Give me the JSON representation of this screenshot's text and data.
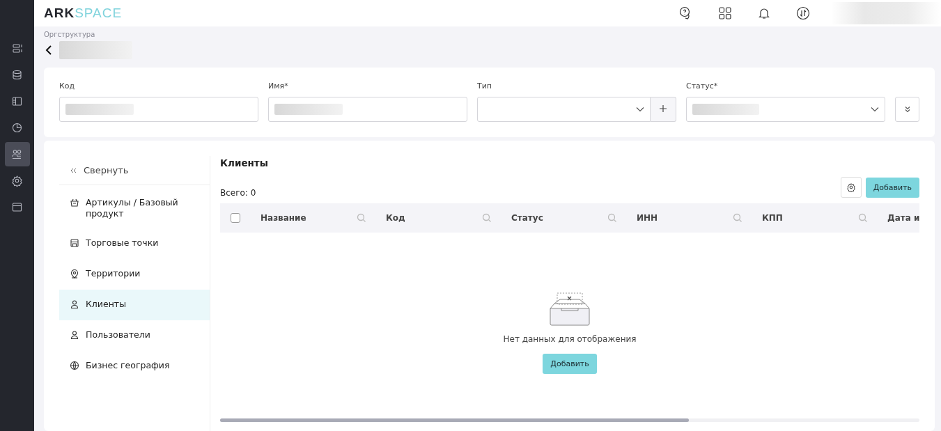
{
  "logo": {
    "bold": "ARK",
    "light": "SPACE"
  },
  "rail": [
    {
      "selected": false
    },
    {
      "selected": false
    },
    {
      "selected": false
    },
    {
      "selected": false
    },
    {
      "selected": true
    },
    {
      "selected": false
    },
    {
      "selected": false
    }
  ],
  "breadcrumb": "Оргструктура",
  "form_fields": [
    {
      "label": "Код",
      "kind": "text"
    },
    {
      "label": "Имя*",
      "kind": "text"
    },
    {
      "label": "Тип",
      "kind": "select_add"
    },
    {
      "label": "Статус*",
      "kind": "select"
    }
  ],
  "nav": {
    "collapse": "Свернуть",
    "items": [
      {
        "label": "Артикулы / Базовый продукт",
        "selected": false
      },
      {
        "label": "Торговые точки",
        "selected": false
      },
      {
        "label": "Территории",
        "selected": false
      },
      {
        "label": "Клиенты",
        "selected": true
      },
      {
        "label": "Пользователи",
        "selected": false
      },
      {
        "label": "Бизнес география",
        "selected": false
      }
    ]
  },
  "section_title": "Клиенты",
  "total": "Всего: 0",
  "add_button": "Добавить",
  "table": {
    "columns": [
      "Название",
      "Код",
      "Статус",
      "ИНН",
      "КПП",
      "Дата и"
    ],
    "header_checkbox": {
      "checked": false
    }
  },
  "empty": {
    "message": "Нет данных для отображения",
    "button": "Добавить"
  }
}
